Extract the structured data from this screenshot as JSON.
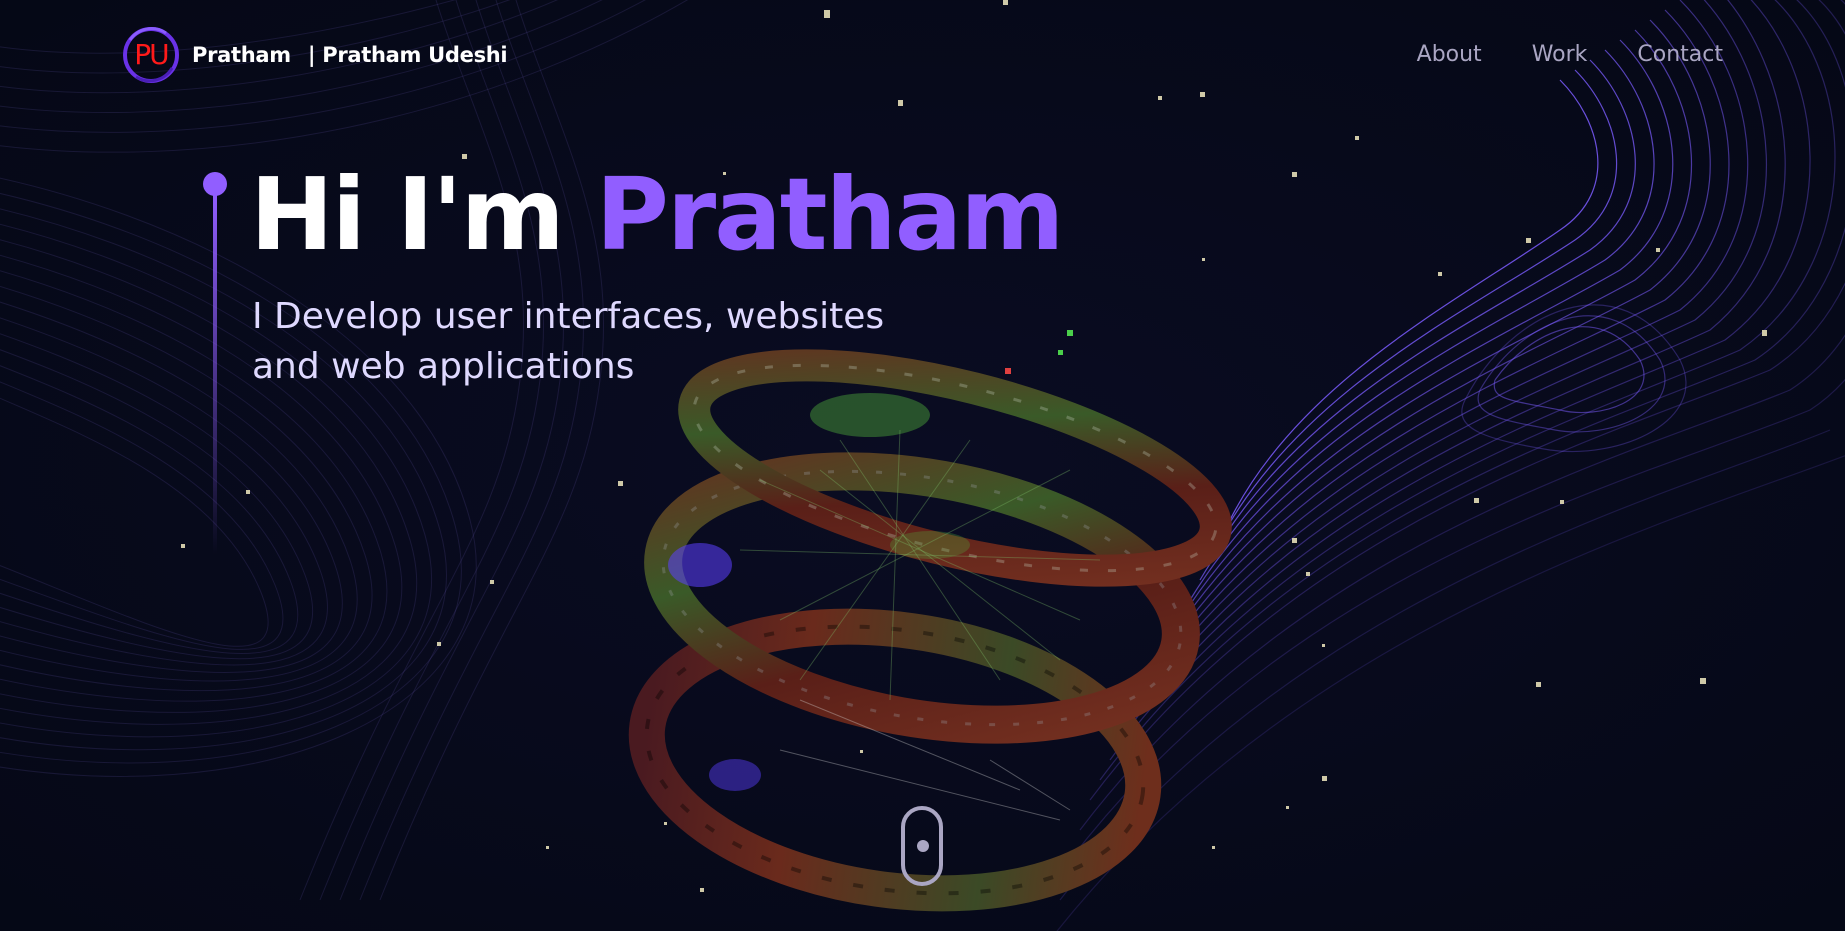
{
  "navbar": {
    "logo_text": "PU",
    "brand_name": "Pratham",
    "brand_full": "| Pratham Udeshi",
    "links": [
      {
        "label": "About"
      },
      {
        "label": "Work"
      },
      {
        "label": "Contact"
      }
    ]
  },
  "hero": {
    "greeting": "Hi I'm",
    "name": "Pratham",
    "subtitle_line1": "I Develop user interfaces, websites",
    "subtitle_line2": "and web applications"
  },
  "colors": {
    "background": "#050816",
    "accent": "#915eff",
    "nav_text": "#aaa6c3",
    "logo_red": "#ff1a1a"
  },
  "icons": {
    "logo": "pu-monogram-icon",
    "scroll": "mouse-scroll-icon",
    "scene": "3d-ring-structure"
  }
}
